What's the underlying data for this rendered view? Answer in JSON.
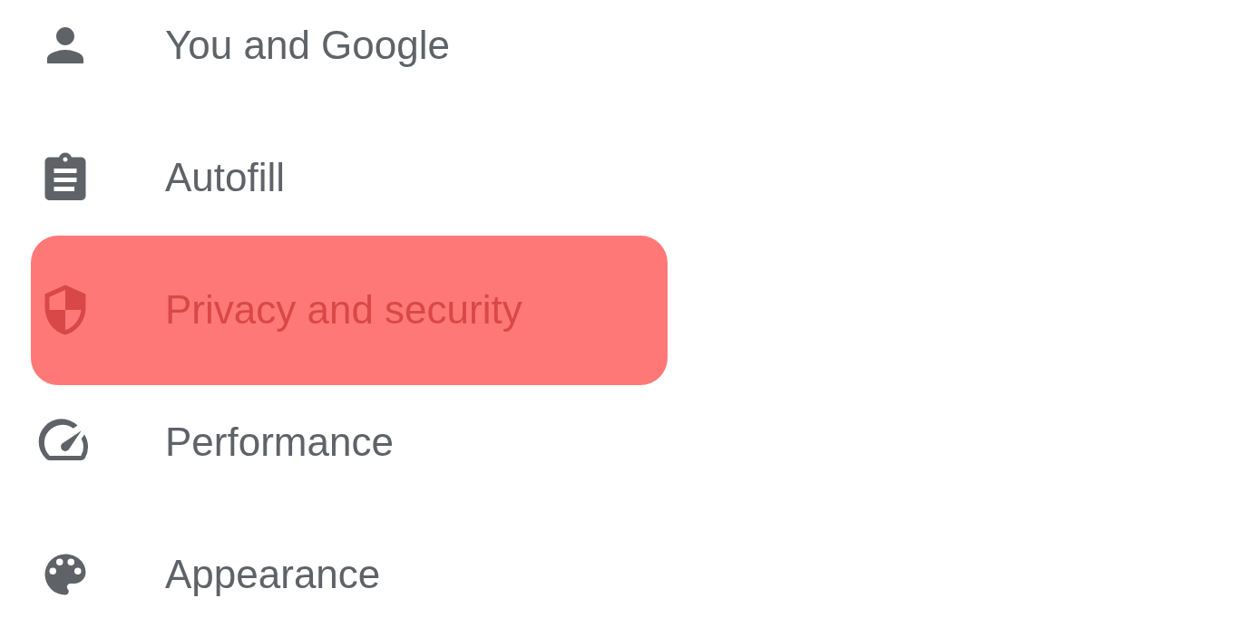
{
  "menu": {
    "items": [
      {
        "label": "You and Google",
        "selected": false
      },
      {
        "label": "Autofill",
        "selected": false
      },
      {
        "label": "Privacy and security",
        "selected": true
      },
      {
        "label": "Performance",
        "selected": false
      },
      {
        "label": "Appearance",
        "selected": false
      }
    ]
  }
}
